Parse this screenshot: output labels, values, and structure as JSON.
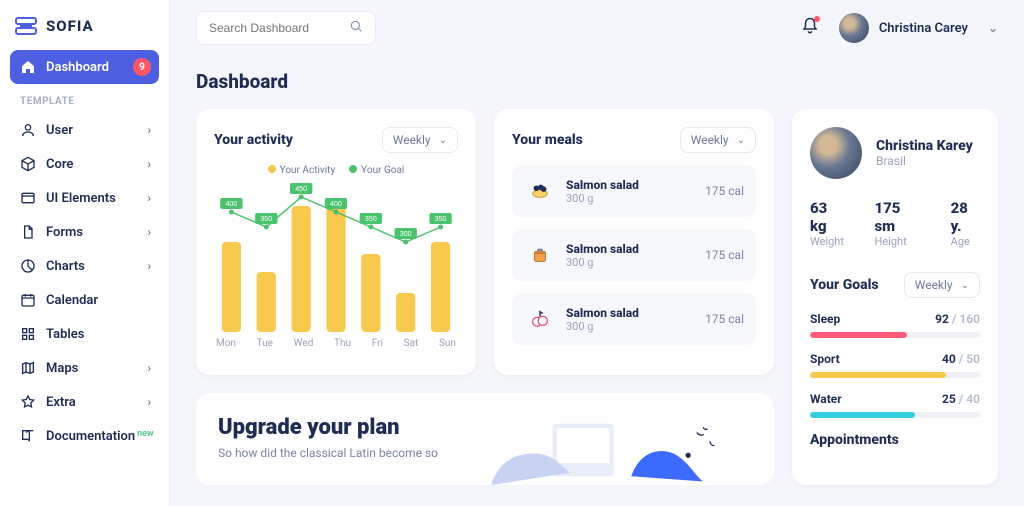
{
  "brand": "SOFIA",
  "search_placeholder": "Search Dashboard",
  "topbar": {
    "username": "Christina Carey"
  },
  "nav": {
    "active": {
      "label": "Dashboard",
      "badge": "9"
    },
    "section_label": "TEMPLATE",
    "items": [
      {
        "label": "User",
        "chevron": true
      },
      {
        "label": "Core",
        "chevron": true
      },
      {
        "label": "UI Elements",
        "chevron": true
      },
      {
        "label": "Forms",
        "chevron": true
      },
      {
        "label": "Charts",
        "chevron": true
      },
      {
        "label": "Calendar",
        "chevron": false
      },
      {
        "label": "Tables",
        "chevron": false
      },
      {
        "label": "Maps",
        "chevron": true
      },
      {
        "label": "Extra",
        "chevron": true
      },
      {
        "label": "Documentation",
        "chevron": false,
        "new": "new"
      }
    ]
  },
  "page_title": "Dashboard",
  "activity": {
    "title": "Your activity",
    "range_label": "Weekly",
    "legend_activity": "Your Activity",
    "legend_goal": "Your Goal"
  },
  "chart_data": {
    "type": "bar",
    "categories": [
      "Mon",
      "Tue",
      "Wed",
      "Thu",
      "Fri",
      "Sat",
      "Sun"
    ],
    "series": [
      {
        "name": "Your Activity",
        "values": [
          300,
          200,
          420,
          420,
          260,
          130,
          300
        ]
      },
      {
        "name": "Your Goal",
        "values": [
          400,
          350,
          450,
          400,
          350,
          300,
          350
        ]
      }
    ],
    "title": "Your activity",
    "xlabel": "",
    "ylabel": "",
    "ylim": [
      0,
      500
    ]
  },
  "meals": {
    "title": "Your meals",
    "range_label": "Weekly",
    "items": [
      {
        "name": "Salmon salad",
        "amount": "300 g",
        "cal": "175 cal"
      },
      {
        "name": "Salmon salad",
        "amount": "300 g",
        "cal": "175 cal"
      },
      {
        "name": "Salmon salad",
        "amount": "300 g",
        "cal": "175 cal"
      }
    ]
  },
  "profile": {
    "name": "Christina Karey",
    "location": "Brasil",
    "stats": [
      {
        "value": "63 kg",
        "label": "Weight"
      },
      {
        "value": "175 sm",
        "label": "Height"
      },
      {
        "value": "28 y.",
        "label": "Age"
      }
    ],
    "goals_title": "Your Goals",
    "goals_range": "Weekly",
    "goals": [
      {
        "name": "Sleep",
        "value": "92",
        "max": "160",
        "pct": 57,
        "color": "c-pink"
      },
      {
        "name": "Sport",
        "value": "40",
        "max": "50",
        "pct": 80,
        "color": "c-yellow"
      },
      {
        "name": "Water",
        "value": "25",
        "max": "40",
        "pct": 62,
        "color": "c-cyan"
      }
    ],
    "appointments_title": "Appointments"
  },
  "upgrade": {
    "title": "Upgrade your plan",
    "subtitle": "So how did the classical Latin become so"
  }
}
